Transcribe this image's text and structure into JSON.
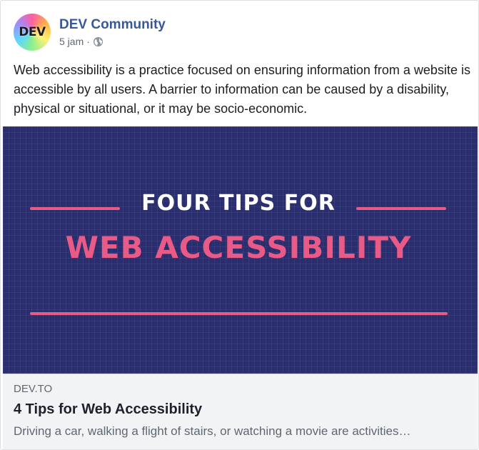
{
  "post": {
    "page_name": "DEV Community",
    "avatar_text": "DEV",
    "timestamp": "5 jam",
    "separator": "·",
    "privacy_icon": "globe-icon",
    "text": "Web accessibility is a practice focused on ensuring information from a website is accessible by all users. A barrier to information can be caused by a disability, physical or situational, or it may be socio-economic."
  },
  "hero_image": {
    "line1": "FOUR TIPS FOR",
    "line2": "WEB ACCESSIBILITY",
    "background_color": "#2a2e6e",
    "accent_color": "#ea5a87"
  },
  "link_preview": {
    "domain": "DEV.TO",
    "title": "4 Tips for Web Accessibility",
    "description": "Driving a car, walking a flight of stairs, or watching a movie are activities…"
  },
  "colors": {
    "page_name": "#385898",
    "secondary_text": "#606770",
    "link_box_bg": "#f2f3f5"
  }
}
